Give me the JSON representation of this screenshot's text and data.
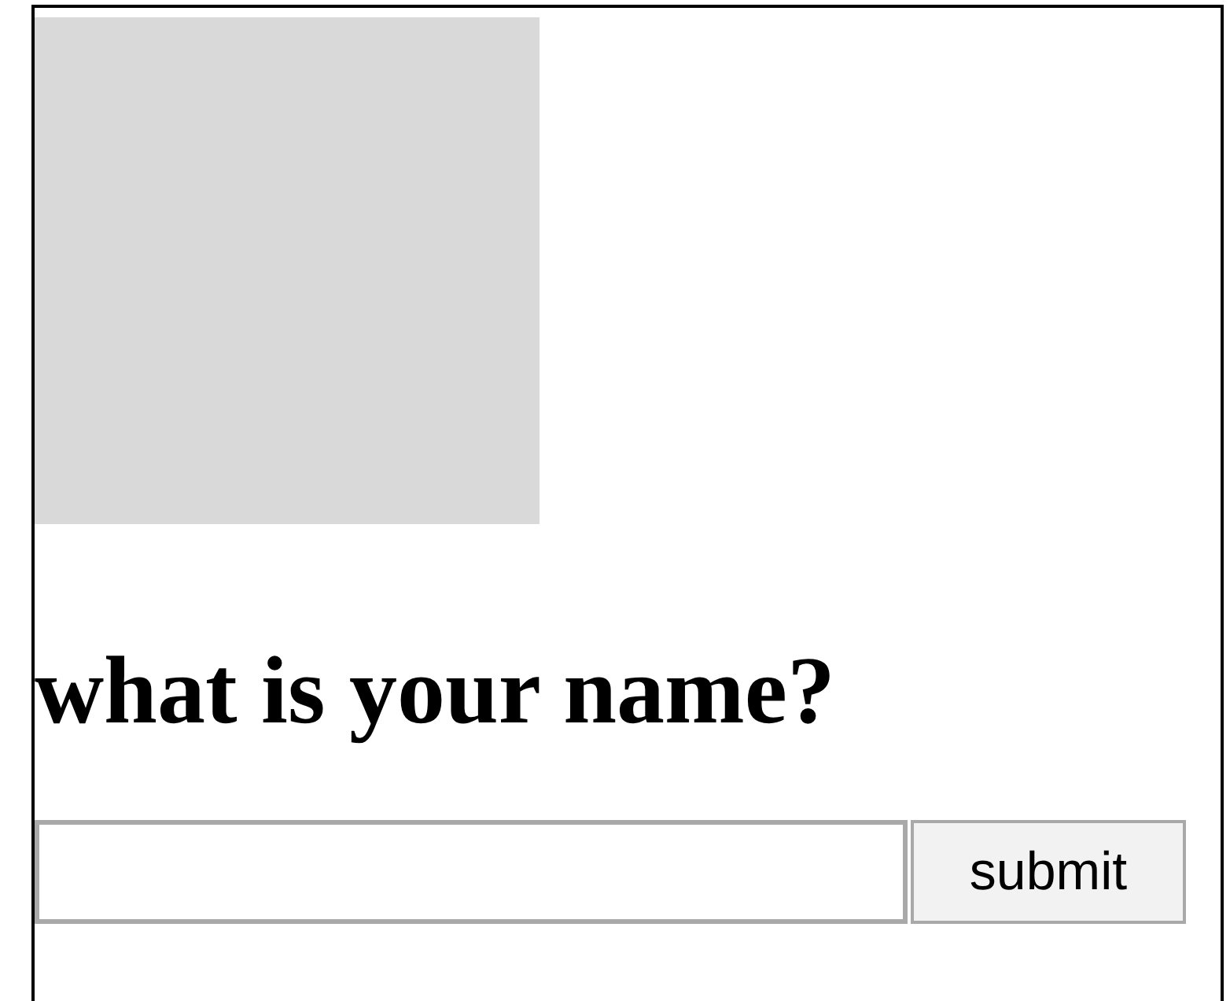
{
  "heading": "what is your name?",
  "form": {
    "button": "submit"
  }
}
